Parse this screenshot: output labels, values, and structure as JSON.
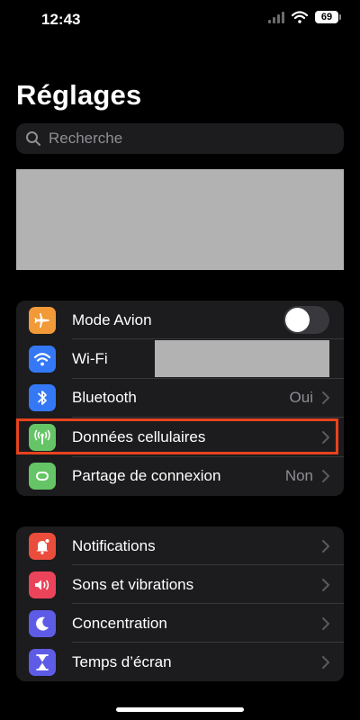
{
  "status_bar": {
    "time": "12:43",
    "battery": "69"
  },
  "title": "Réglages",
  "search": {
    "placeholder": "Recherche"
  },
  "group1": [
    {
      "label": "Mode Avion",
      "icon": "airplane-icon",
      "color": "#f19a37",
      "control": "toggle",
      "toggle_on": false
    },
    {
      "label": "Wi-Fi",
      "icon": "wifi-icon",
      "color": "#3478f6",
      "value": ""
    },
    {
      "label": "Bluetooth",
      "icon": "bluetooth-icon",
      "color": "#3478f6",
      "value": "Oui"
    },
    {
      "label": "Données cellulaires",
      "icon": "antenna-icon",
      "color": "#65c466",
      "value": "",
      "highlighted": true
    },
    {
      "label": "Partage de connexion",
      "icon": "link-icon",
      "color": "#65c466",
      "value": "Non"
    }
  ],
  "group2": [
    {
      "label": "Notifications",
      "icon": "bell-icon",
      "color": "#eb4d3d"
    },
    {
      "label": "Sons et vibrations",
      "icon": "speaker-icon",
      "color": "#eb445a"
    },
    {
      "label": "Concentration",
      "icon": "moon-icon",
      "color": "#5e5ce6"
    },
    {
      "label": "Temps d’écran",
      "icon": "hourglass-icon",
      "color": "#5e5ce6"
    }
  ],
  "colors": {
    "highlight": "#e8421e",
    "redaction": "#b2b2b2"
  }
}
